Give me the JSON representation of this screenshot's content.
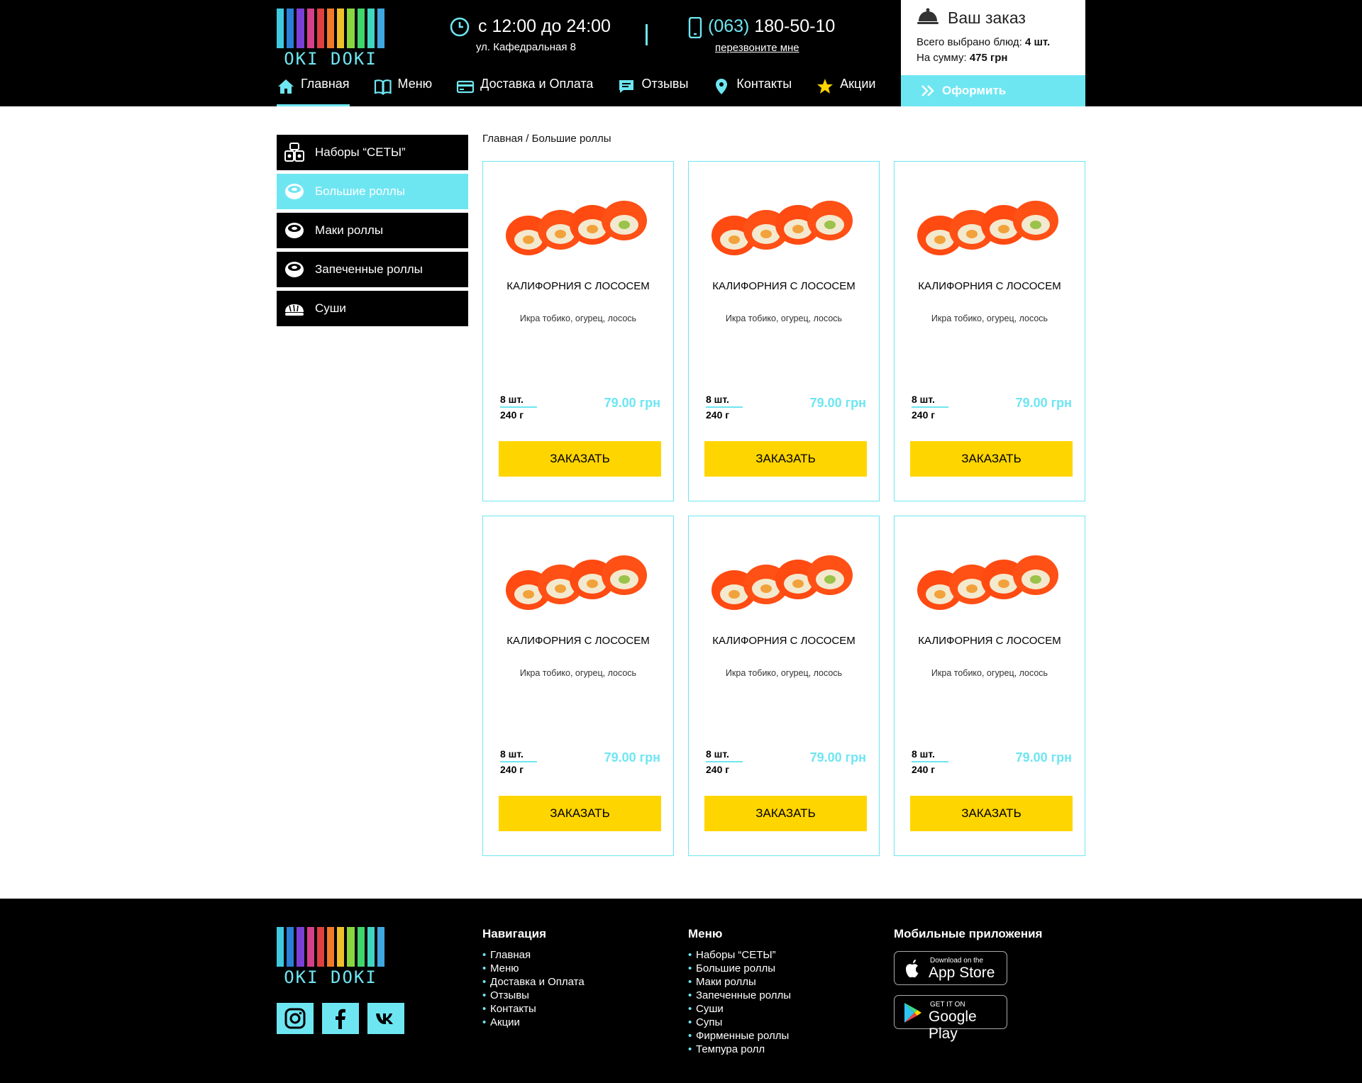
{
  "brand": {
    "name": "OKI DOKI"
  },
  "header": {
    "hours": "с 12:00 до 24:00",
    "address": "ул. Кафедральная 8",
    "phone_code": "(063)",
    "phone_number": " 180-50-10",
    "callback": "перезвоните мне"
  },
  "nav": [
    {
      "label": "Главная",
      "icon": "home-icon"
    },
    {
      "label": "Меню",
      "icon": "book-icon"
    },
    {
      "label": "Доставка и Оплата",
      "icon": "card-icon"
    },
    {
      "label": "Отзывы",
      "icon": "comment-icon"
    },
    {
      "label": "Контакты",
      "icon": "map-pin-icon"
    },
    {
      "label": "Акции",
      "icon": "star-icon"
    }
  ],
  "order": {
    "title": "Ваш заказ",
    "count_label": "Всего выбрано блюд:",
    "count_value": "4 шт.",
    "sum_label": "На сумму:",
    "sum_value": "475 грн",
    "checkout": "Оформить"
  },
  "sidebar": [
    {
      "label": "Наборы “СЕТЫ”",
      "icon": "sushi-set-icon"
    },
    {
      "label": "Большие роллы",
      "icon": "roll-icon"
    },
    {
      "label": "Маки роллы",
      "icon": "roll-icon"
    },
    {
      "label": "Запеченные роллы",
      "icon": "roll-icon"
    },
    {
      "label": "Суши",
      "icon": "nigiri-icon"
    }
  ],
  "breadcrumb": "Главная / Большие роллы",
  "products": [
    {
      "name": "КАЛИФОРНИЯ С ЛОСОСЕМ",
      "desc": "Икра тобико, огурец, лосось",
      "pcs": "8 шт.",
      "weight": "240 г",
      "price": "79.00 грн",
      "button": "ЗАКАЗАТЬ"
    },
    {
      "name": "КАЛИФОРНИЯ С ЛОСОСЕМ",
      "desc": "Икра тобико, огурец, лосось",
      "pcs": "8 шт.",
      "weight": "240 г",
      "price": "79.00 грн",
      "button": "ЗАКАЗАТЬ"
    },
    {
      "name": "КАЛИФОРНИЯ С ЛОСОСЕМ",
      "desc": "Икра тобико, огурец, лосось",
      "pcs": "8 шт.",
      "weight": "240 г",
      "price": "79.00 грн",
      "button": "ЗАКАЗАТЬ"
    },
    {
      "name": "КАЛИФОРНИЯ С ЛОСОСЕМ",
      "desc": "Икра тобико, огурец, лосось",
      "pcs": "8 шт.",
      "weight": "240 г",
      "price": "79.00 грн",
      "button": "ЗАКАЗАТЬ"
    },
    {
      "name": "КАЛИФОРНИЯ С ЛОСОСЕМ",
      "desc": "Икра тобико, огурец, лосось",
      "pcs": "8 шт.",
      "weight": "240 г",
      "price": "79.00 грн",
      "button": "ЗАКАЗАТЬ"
    },
    {
      "name": "КАЛИФОРНИЯ С ЛОСОСЕМ",
      "desc": "Икра тобико, огурец, лосось",
      "pcs": "8 шт.",
      "weight": "240 г",
      "price": "79.00 грн",
      "button": "ЗАКАЗАТЬ"
    }
  ],
  "footer": {
    "nav_title": "Навигация",
    "nav_items": [
      "Главная",
      "Меню",
      "Доставка и Оплата",
      "Отзывы",
      "Контакты",
      "Акции"
    ],
    "menu_title": "Меню",
    "menu_items": [
      "Наборы “СЕТЫ”",
      "Большие роллы",
      "Маки роллы",
      "Запеченные роллы",
      "Суши",
      "Супы",
      "Фирменные роллы",
      "Темпура ролл"
    ],
    "apps_title": "Мобильные приложения",
    "appstore_small": "Download on the",
    "appstore_big": "App Store",
    "googleplay_small": "GET IT ON",
    "googleplay_big": "Google Play",
    "socials": [
      "instagram-icon",
      "facebook-icon",
      "vk-icon"
    ]
  },
  "colors": {
    "accent": "#6ee6f2",
    "button": "#ffd500",
    "header_bg": "#000000"
  }
}
